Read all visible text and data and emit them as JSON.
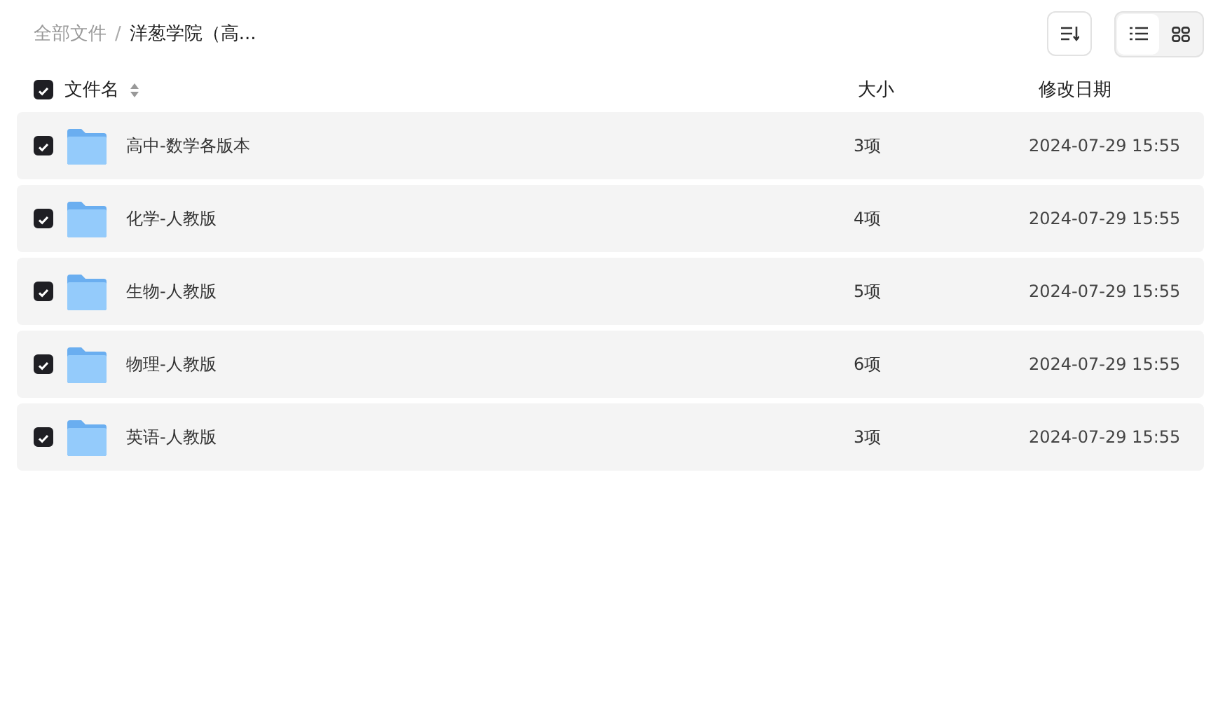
{
  "breadcrumb": [
    {
      "label": "全部文件"
    },
    {
      "label": "洋葱学院（高..."
    }
  ],
  "breadcrumb_separator": "/",
  "view_modes": [
    {
      "kind": "list",
      "selected": true
    },
    {
      "kind": "grid",
      "selected": false
    }
  ],
  "table": {
    "all_checked": true,
    "columns": [
      "文件名",
      "大小",
      "修改日期"
    ],
    "rows": [
      {
        "name": "高中-数学各版本",
        "size": "3项",
        "date": "2024-07-29 15:55",
        "checked": true
      },
      {
        "name": "化学-人教版",
        "size": "4项",
        "date": "2024-07-29 15:55",
        "checked": true
      },
      {
        "name": "生物-人教版",
        "size": "5项",
        "date": "2024-07-29 15:55",
        "checked": true
      },
      {
        "name": "物理-人教版",
        "size": "6项",
        "date": "2024-07-29 15:55",
        "checked": true
      },
      {
        "name": "英语-人教版",
        "size": "3项",
        "date": "2024-07-29 15:55",
        "checked": true
      }
    ]
  }
}
